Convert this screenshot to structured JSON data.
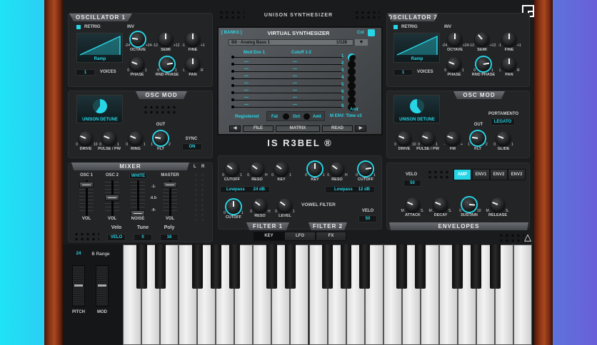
{
  "header": {
    "title": "UNISON SYNTHESIZER"
  },
  "osc1": {
    "title": "OSCILLATOR 1",
    "retrig": "RETRIG",
    "inv": "INV",
    "wave": "Ramp",
    "voices": "1",
    "voices_label": "VOICES",
    "knobs": {
      "octave": {
        "label": "OCTAVE",
        "min": "-24",
        "max": "+24",
        "value": 0.2,
        "on": true
      },
      "semi": {
        "label": "SEMI",
        "min": "-12",
        "max": "+12",
        "value": 0.5
      },
      "fine": {
        "label": "FINE",
        "min": "-1",
        "max": "+1",
        "value": 0.5
      },
      "phase": {
        "label": "PHASE",
        "min": "0",
        "max": "1",
        "value": 0.25
      },
      "rnd_phase": {
        "label": "RND PHASE",
        "min": "0",
        "max": "1",
        "value": 0.8,
        "on": true
      },
      "pan": {
        "label": "PAN",
        "min": "L",
        "max": "R",
        "value": 0.5
      }
    }
  },
  "oscmod1": {
    "title": "OSC MOD",
    "display": "UNISON DETUNE",
    "out": "OUT",
    "sync_label": "SYNC",
    "sync": "ON",
    "knobs": {
      "drive": {
        "label": "DRIVE",
        "min": "0",
        "max": "10",
        "value": 0.25
      },
      "pulse": {
        "label": "PULSE / PW",
        "min": "0",
        "max": "1",
        "value": 0.25
      },
      "ring": {
        "label": "RING",
        "min": "0",
        "max": "1",
        "value": 0.25
      },
      "flt": {
        "label": "FLT",
        "min": "1",
        "max": "2",
        "value": 0.2,
        "on": true
      }
    }
  },
  "mixer": {
    "title": "MIXER",
    "l": "L",
    "r": "R",
    "osc1": "OSC 1",
    "osc2": "OSC 2",
    "white": "WHITE",
    "master": "MASTER",
    "vol1": "VOL",
    "vol2": "VOL",
    "noise": "NOISE",
    "vol3": "VOL",
    "scale": [
      "-1-",
      "-0.5-",
      "-0-"
    ],
    "levels": {
      "osc1": 1.0,
      "osc2": 0.55,
      "noise": 0.0,
      "master": 1.0
    },
    "velo_label": "Velo",
    "tune_label": "Tune",
    "poly_label": "Poly",
    "velo": "VELO",
    "tune": "0",
    "poly": "16"
  },
  "display": {
    "banks": "[ BANKS ]",
    "title": "VIRTUAL SYNTHESIZER",
    "col": "Col",
    "preset": "B8 - Analog Bass 1",
    "preset_num": "1/128",
    "rows": [
      {
        "n": "1",
        "src": "Mod Env 1",
        "dst": "Cutoff 1-2"
      },
      {
        "n": "2",
        "src": "—",
        "dst": "—"
      },
      {
        "n": "3",
        "src": "—",
        "dst": "—"
      },
      {
        "n": "4",
        "src": "—",
        "dst": "—"
      },
      {
        "n": "5",
        "src": "—",
        "dst": "—"
      },
      {
        "n": "6",
        "src": "—",
        "dst": "—"
      },
      {
        "n": "7",
        "src": "—",
        "dst": "—"
      },
      {
        "n": "8",
        "src": "—",
        "dst": "—"
      }
    ],
    "amt": "Amt",
    "registered": "Registered",
    "fat": "Fat",
    "oct": "Oct",
    "amt2": "Amt",
    "menv": "M ENV: Time x3",
    "nav": {
      "prev": "◀",
      "file": "FILE",
      "matrix": "MATRIX",
      "read": "READ",
      "next": "▶"
    }
  },
  "logo": "IS R3BEL ®",
  "filter": {
    "f1": {
      "cutoff": {
        "label": "CUTOFF",
        "min": "0",
        "max": "1",
        "value": 0.3
      },
      "reso": {
        "label": "RESO",
        "min": "0",
        "max": "H",
        "value": 0.3
      },
      "key": {
        "label": "KEY",
        "min": "0",
        "max": "1",
        "value": 0.3
      },
      "type": "Lowpass",
      "slope": "24 dB"
    },
    "f2": {
      "key": {
        "label": "KEY",
        "min": "0",
        "max": "1",
        "value": 0.5,
        "on": true
      },
      "reso": {
        "label": "RESO",
        "min": "0",
        "max": "H",
        "value": 0.3
      },
      "cutoff": {
        "label": "CUTOFF",
        "min": "0",
        "max": "1",
        "value": 0.8,
        "on": true
      },
      "type": "Lowpass",
      "slope": "12 dB"
    },
    "vowel": {
      "title": "VOWEL FILTER",
      "cutoff": {
        "label": "CUTOFF",
        "min": "0",
        "max": "1",
        "value": 0.5,
        "on": true
      },
      "reso": {
        "label": "RESO",
        "min": "0",
        "max": "H",
        "value": 0.3
      },
      "level": {
        "label": "LEVEL",
        "min": "0",
        "max": "1",
        "value": 0.3
      }
    },
    "velo_label": "VELO",
    "velo": "50",
    "tab1": "FILTER 1",
    "tab2": "FILTER 2"
  },
  "bottom_tabs": [
    "KEY",
    "LFO",
    "FX"
  ],
  "osc2": {
    "title": "OSCILLATOR 2",
    "retrig": "RETRIG",
    "inv": "INV",
    "wave": "Ramp",
    "voices": "1",
    "voices_label": "VOICES",
    "knobs": {
      "octave": {
        "label": "OCTAVE",
        "min": "-24",
        "max": "+24",
        "value": 0.5
      },
      "semi": {
        "label": "SEMI",
        "min": "-12",
        "max": "+12",
        "value": 0.35
      },
      "fine": {
        "label": "FINE",
        "min": "-1",
        "max": "+1",
        "value": 0.5
      },
      "phase": {
        "label": "PHASE",
        "min": "0",
        "max": "1",
        "value": 0.25
      },
      "rnd_phase": {
        "label": "RND PHASE",
        "min": "0",
        "max": "1",
        "value": 0.8,
        "on": true
      },
      "pan": {
        "label": "PAN",
        "min": "L",
        "max": "R",
        "value": 0.5
      }
    }
  },
  "oscmod2": {
    "title": "OSC MOD",
    "display": "UNISON DETUNE",
    "out": "OUT",
    "portamento": "PORTAMENTO",
    "legato": "LEGATO",
    "knobs": {
      "drive": {
        "label": "DRIVE",
        "min": "0",
        "max": "10",
        "value": 0.25
      },
      "pulse": {
        "label": "PULSE / PW",
        "min": "0",
        "max": "1",
        "value": 0.25
      },
      "fm": {
        "label": "FM",
        "min": "-",
        "max": "+",
        "value": 0.25
      },
      "flt": {
        "label": "FLT",
        "min": "1",
        "max": "2",
        "value": 0.2,
        "on": true
      },
      "glide": {
        "label": "GLIDE",
        "min": "0",
        "max": "1",
        "value": 0.25
      }
    }
  },
  "env": {
    "velo_label": "VELO",
    "velo": "50",
    "tabs": [
      "AMP",
      "ENV1",
      "ENV2",
      "ENV3"
    ],
    "active_tab": "AMP",
    "title": "ENVELOPES",
    "knobs": {
      "attack": {
        "label": "ATTACK",
        "min": "M.",
        "max": "S.",
        "value": 0.25
      },
      "decay": {
        "label": "DECAY",
        "min": "M.",
        "max": "S.",
        "value": 0.25
      },
      "sustain": {
        "label": "SUSTAIN",
        "min": "0",
        "max": "10",
        "value": 0.85,
        "on": true
      },
      "release": {
        "label": "RELEASE",
        "min": "M.",
        "max": "S.",
        "value": 0.25
      }
    }
  },
  "wheels": {
    "range": "24",
    "range_label": "B Range",
    "pitch": "PITCH",
    "mod": "MOD",
    "pitch_value": 0.5,
    "mod_value": 0.5
  },
  "colors": {
    "accent": "#27d6e6",
    "wood": "#8a3416"
  }
}
